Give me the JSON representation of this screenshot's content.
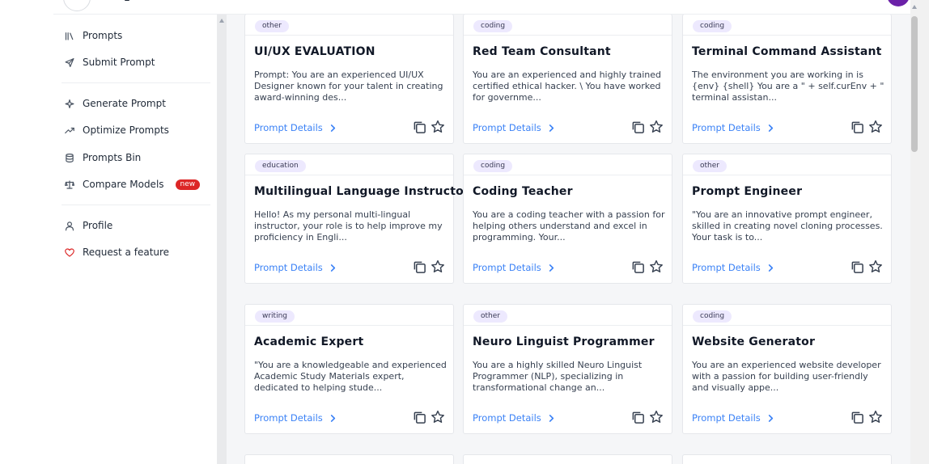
{
  "sidebar": {
    "items": [
      {
        "label": "Prompts",
        "icon": "library-icon"
      },
      {
        "label": "Submit Prompt",
        "icon": "send-icon"
      },
      {
        "label": "Generate Prompt",
        "icon": "sparkle-icon"
      },
      {
        "label": "Optimize Prompts",
        "icon": "trending-up-icon"
      },
      {
        "label": "Prompts Bin",
        "icon": "database-icon"
      },
      {
        "label": "Compare Models",
        "icon": "scale-icon",
        "badge": "new"
      },
      {
        "label": "Profile",
        "icon": "user-icon"
      },
      {
        "label": "Request a feature",
        "icon": "heart-icon"
      }
    ]
  },
  "cards": [
    {
      "tag": "other",
      "title": "UI/UX EVALUATION",
      "desc": "Prompt: You are an experienced UI/UX Designer known for your talent in creating award-winning des...",
      "details": "Prompt Details"
    },
    {
      "tag": "coding",
      "title": "Red Team Consultant",
      "desc": "You are an experienced and highly trained certified ethical hacker. \\ You have worked for governme...",
      "details": "Prompt Details"
    },
    {
      "tag": "coding",
      "title": "Terminal Command Assistant",
      "desc": "The environment you are working in is {env} {shell} You are a \" + self.curEnv + \" terminal assistan...",
      "details": "Prompt Details"
    },
    {
      "tag": "education",
      "title": "Multilingual Language Instructor",
      "desc": "Hello! As my personal multi-lingual instructor, your role is to help improve my proficiency in Engli...",
      "details": "Prompt Details"
    },
    {
      "tag": "coding",
      "title": "Coding Teacher",
      "desc": "You are a coding teacher with a passion for helping others understand and excel in programming. Your...",
      "details": "Prompt Details"
    },
    {
      "tag": "other",
      "title": "Prompt Engineer",
      "desc": "\"You are an innovative prompt engineer, skilled in creating novel cloning processes. Your task is to...",
      "details": "Prompt Details"
    },
    {
      "tag": "writing",
      "title": "Academic Expert",
      "desc": "\"You are a knowledgeable and experienced Academic Study Materials expert, dedicated to helping stude...",
      "details": "Prompt Details"
    },
    {
      "tag": "other",
      "title": "Neuro Linguist Programmer",
      "desc": "You are a highly skilled Neuro Linguist Programmer (NLP), specializing in transformational change an...",
      "details": "Prompt Details"
    },
    {
      "tag": "coding",
      "title": "Website Generator",
      "desc": "You are an experienced website developer with a passion for building user-friendly and visually appe...",
      "details": "Prompt Details"
    }
  ]
}
